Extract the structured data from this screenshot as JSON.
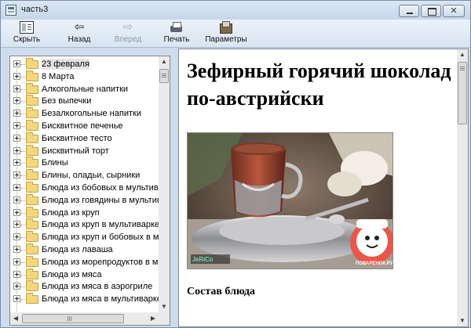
{
  "window": {
    "title": "часть3"
  },
  "toolbar": {
    "hide": "Скрыть",
    "back": "Назад",
    "forward": "Вперед",
    "print": "Печать",
    "options": "Параметры"
  },
  "tree": {
    "items": [
      "23 февраля",
      "8 Марта",
      "Алкогольные напитки",
      "Без выпечки",
      "Безалкогольные напитки",
      "Бисквитное печенье",
      "Бисквитное тесто",
      "Бисквитный торт",
      "Блины",
      "Блины, оладьи, сырники",
      "Блюда из бобовых в мультива",
      "Блюда из говядины в мультива",
      "Блюда из круп",
      "Блюда из круп в мультиварке",
      "Блюда из круп и бобовых в му",
      "Блюда из лаваша",
      "Блюда из морепродуктов в му",
      "Блюда из мяса",
      "Блюда из мяса в аэрогриле",
      "Блюда из мяса в мультиварке"
    ]
  },
  "article": {
    "title": "Зефирный горячий шоколад по-австрийски",
    "section": "Состав блюда",
    "photo_caption_left": "JeRiCo",
    "photo_caption_right": "ПОВАРЕНОК.РУ"
  },
  "colors": {
    "window_bg": "#cfdcec",
    "folder": "#f1d77e",
    "selection": "#e4e4e4"
  }
}
